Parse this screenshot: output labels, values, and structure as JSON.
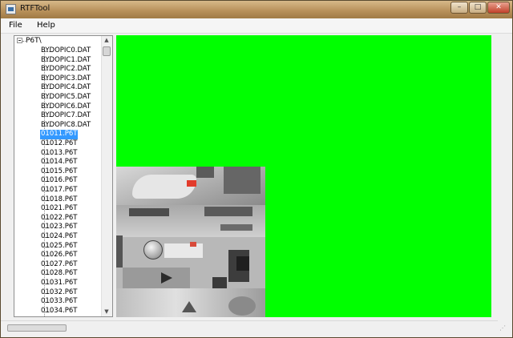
{
  "window": {
    "title": "RTFTool"
  },
  "window_controls": {
    "minimize": "–",
    "maximize": "□",
    "close": "✕"
  },
  "menu": {
    "file": "File",
    "help": "Help"
  },
  "tree": {
    "root": "P6T\\",
    "selected_index": 9,
    "items": [
      "BYDOPIC0.DAT",
      "BYDOPIC1.DAT",
      "BYDOPIC2.DAT",
      "BYDOPIC3.DAT",
      "BYDOPIC4.DAT",
      "BYDOPIC5.DAT",
      "BYDOPIC6.DAT",
      "BYDOPIC7.DAT",
      "BYDOPIC8.DAT",
      "01011.P6T",
      "01012.P6T",
      "01013.P6T",
      "01014.P6T",
      "01015.P6T",
      "01016.P6T",
      "01017.P6T",
      "01018.P6T",
      "01021.P6T",
      "01022.P6T",
      "01023.P6T",
      "01024.P6T",
      "01025.P6T",
      "01026.P6T",
      "01027.P6T",
      "01028.P6T",
      "01031.P6T",
      "01032.P6T",
      "01033.P6T",
      "01034.P6T"
    ]
  },
  "icons": {
    "scroll_up": "▲",
    "scroll_down": "▼",
    "grip": "⋰"
  },
  "colors": {
    "canvas_background": "#00ff00",
    "selection": "#3399ff"
  }
}
